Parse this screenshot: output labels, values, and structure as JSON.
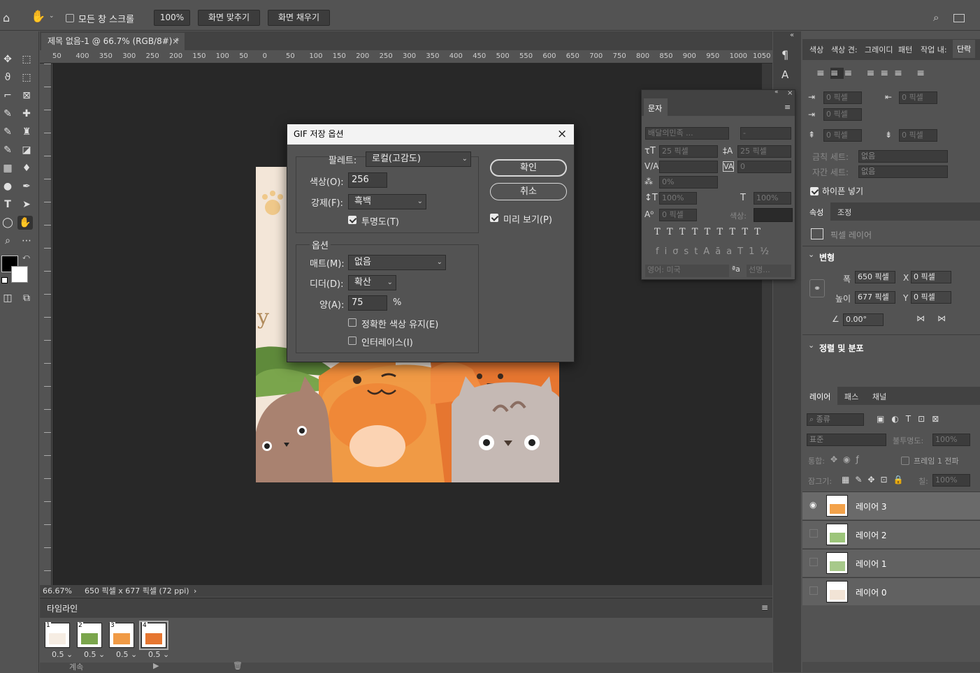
{
  "options_bar": {
    "scroll_all_label": "모든 창 스크롤",
    "zoom_100": "100%",
    "fit_screen": "화면 맞추기",
    "fill_screen": "화면 채우기"
  },
  "document": {
    "tab_title": "제목 없음-1 @ 66.7% (RGB/8#) *",
    "zoom_status": "66.67%",
    "doc_info": "650 픽셀 x 677 픽셀 (72 ppi)",
    "ruler_labels": [
      "50",
      "400",
      "350",
      "300",
      "250",
      "200",
      "150",
      "100",
      "50",
      "0",
      "50",
      "100",
      "150",
      "200",
      "250",
      "300",
      "350",
      "400",
      "450",
      "500",
      "550",
      "600",
      "650",
      "700",
      "750",
      "800",
      "850",
      "900",
      "950",
      "1000",
      "1050"
    ]
  },
  "dialog": {
    "title": "GIF 저장 옵션",
    "palette_label": "팔레트:",
    "palette_value": "로컬(고감도)",
    "colors_label": "색상(O):",
    "colors_value": "256",
    "forced_label": "강제(F):",
    "forced_value": "흑백",
    "transparency_label": "투명도(T)",
    "options_legend": "옵션",
    "matte_label": "매트(M):",
    "matte_value": "없음",
    "dither_label": "디더(D):",
    "dither_value": "확산",
    "amount_label": "양(A):",
    "amount_value": "75",
    "percent": "%",
    "preserve_label": "정확한 색상 유지(E)",
    "interlace_label": "인터레이스(I)",
    "ok": "확인",
    "cancel": "취소",
    "preview_label": "미리 보기(P)"
  },
  "character_panel": {
    "tab": "문자",
    "font_family": "배달의민족 ...",
    "font_style": "-",
    "font_size": "25 픽셀",
    "leading": "25 픽셀",
    "tracking": "0",
    "scale_pct": "0%",
    "vscale": "100%",
    "hscale": "100%",
    "baseline": "0 픽셀",
    "color_label": "색상:",
    "language": "영어: 미국",
    "aa_label": "선명..."
  },
  "right_panel": {
    "tabs": [
      "색상",
      "색상 견:",
      "그레이디",
      "패턴",
      "작업 내:",
      "단락"
    ],
    "para_fields": [
      "0 픽셀",
      "0 픽셀",
      "0 픽셀",
      "0 픽셀",
      "0 픽셀"
    ],
    "kinsoku_label": "금칙 세트:",
    "kinsoku_value": "없음",
    "mojikumi_label": "자간 세트:",
    "mojikumi_value": "없음",
    "hyphenate_label": "하이픈 넣기",
    "props_tabs": [
      "속성",
      "조정"
    ],
    "pixel_layer": "픽셀 레이어",
    "transform": "변형",
    "width_label": "폭",
    "width_value": "650 픽셀",
    "height_label": "높이",
    "height_value": "677 픽셀",
    "x_label": "X",
    "x_value": "0 픽셀",
    "y_label": "Y",
    "y_value": "0 픽셀",
    "angle_value": "0.00°",
    "align_section": "정렬 및 분포",
    "layers_tabs": [
      "레이어",
      "패스",
      "채널"
    ],
    "filter_label": "종류",
    "blend_mode": "표준",
    "opacity_label": "불투명도:",
    "opacity_value": "100%",
    "unify_label": "통합:",
    "propagate_label": "프레임 1 전파",
    "lock_label": "잠그기:",
    "fill_label": "칠:",
    "fill_value": "100%",
    "layers": [
      "레이어 3",
      "레이어 2",
      "레이어 1",
      "레이어 0"
    ]
  },
  "timeline": {
    "title": "타임라인",
    "frames": [
      {
        "num": "1",
        "delay": "0.5"
      },
      {
        "num": "2",
        "delay": "0.5"
      },
      {
        "num": "3",
        "delay": "0.5"
      },
      {
        "num": "4",
        "delay": "0.5"
      }
    ],
    "loop_label": "계속"
  }
}
